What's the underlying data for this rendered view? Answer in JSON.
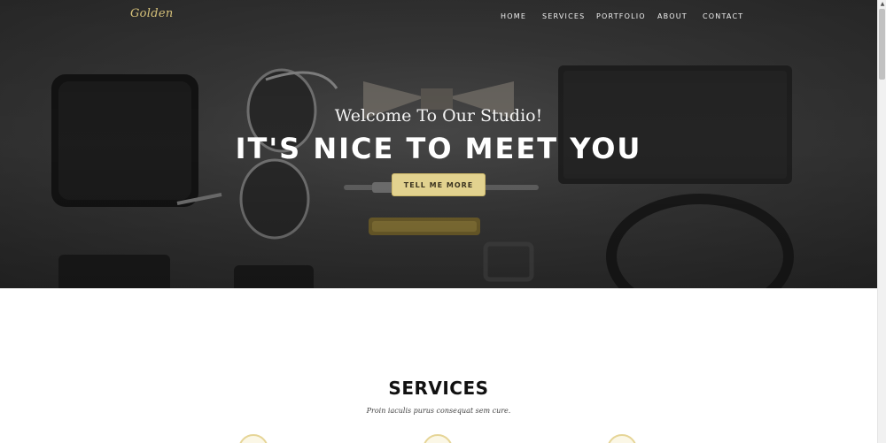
{
  "brand": {
    "logo_text": "Golden",
    "accent_color": "#e2d28f"
  },
  "nav": {
    "items": [
      "HOME",
      "SERVICES",
      "PORTFOLIO",
      "ABOUT",
      "CONTACT"
    ]
  },
  "hero": {
    "subheading": "Welcome To Our Studio!",
    "heading": "IT'S NICE TO MEET YOU",
    "button_label": "TELL ME MORE"
  },
  "services": {
    "title": "SERVICES",
    "subtitle": "Proin iaculis purus consequat sem cure."
  },
  "icons": {
    "service_icons": [
      "service-icon-1",
      "service-icon-2",
      "service-icon-3"
    ]
  }
}
